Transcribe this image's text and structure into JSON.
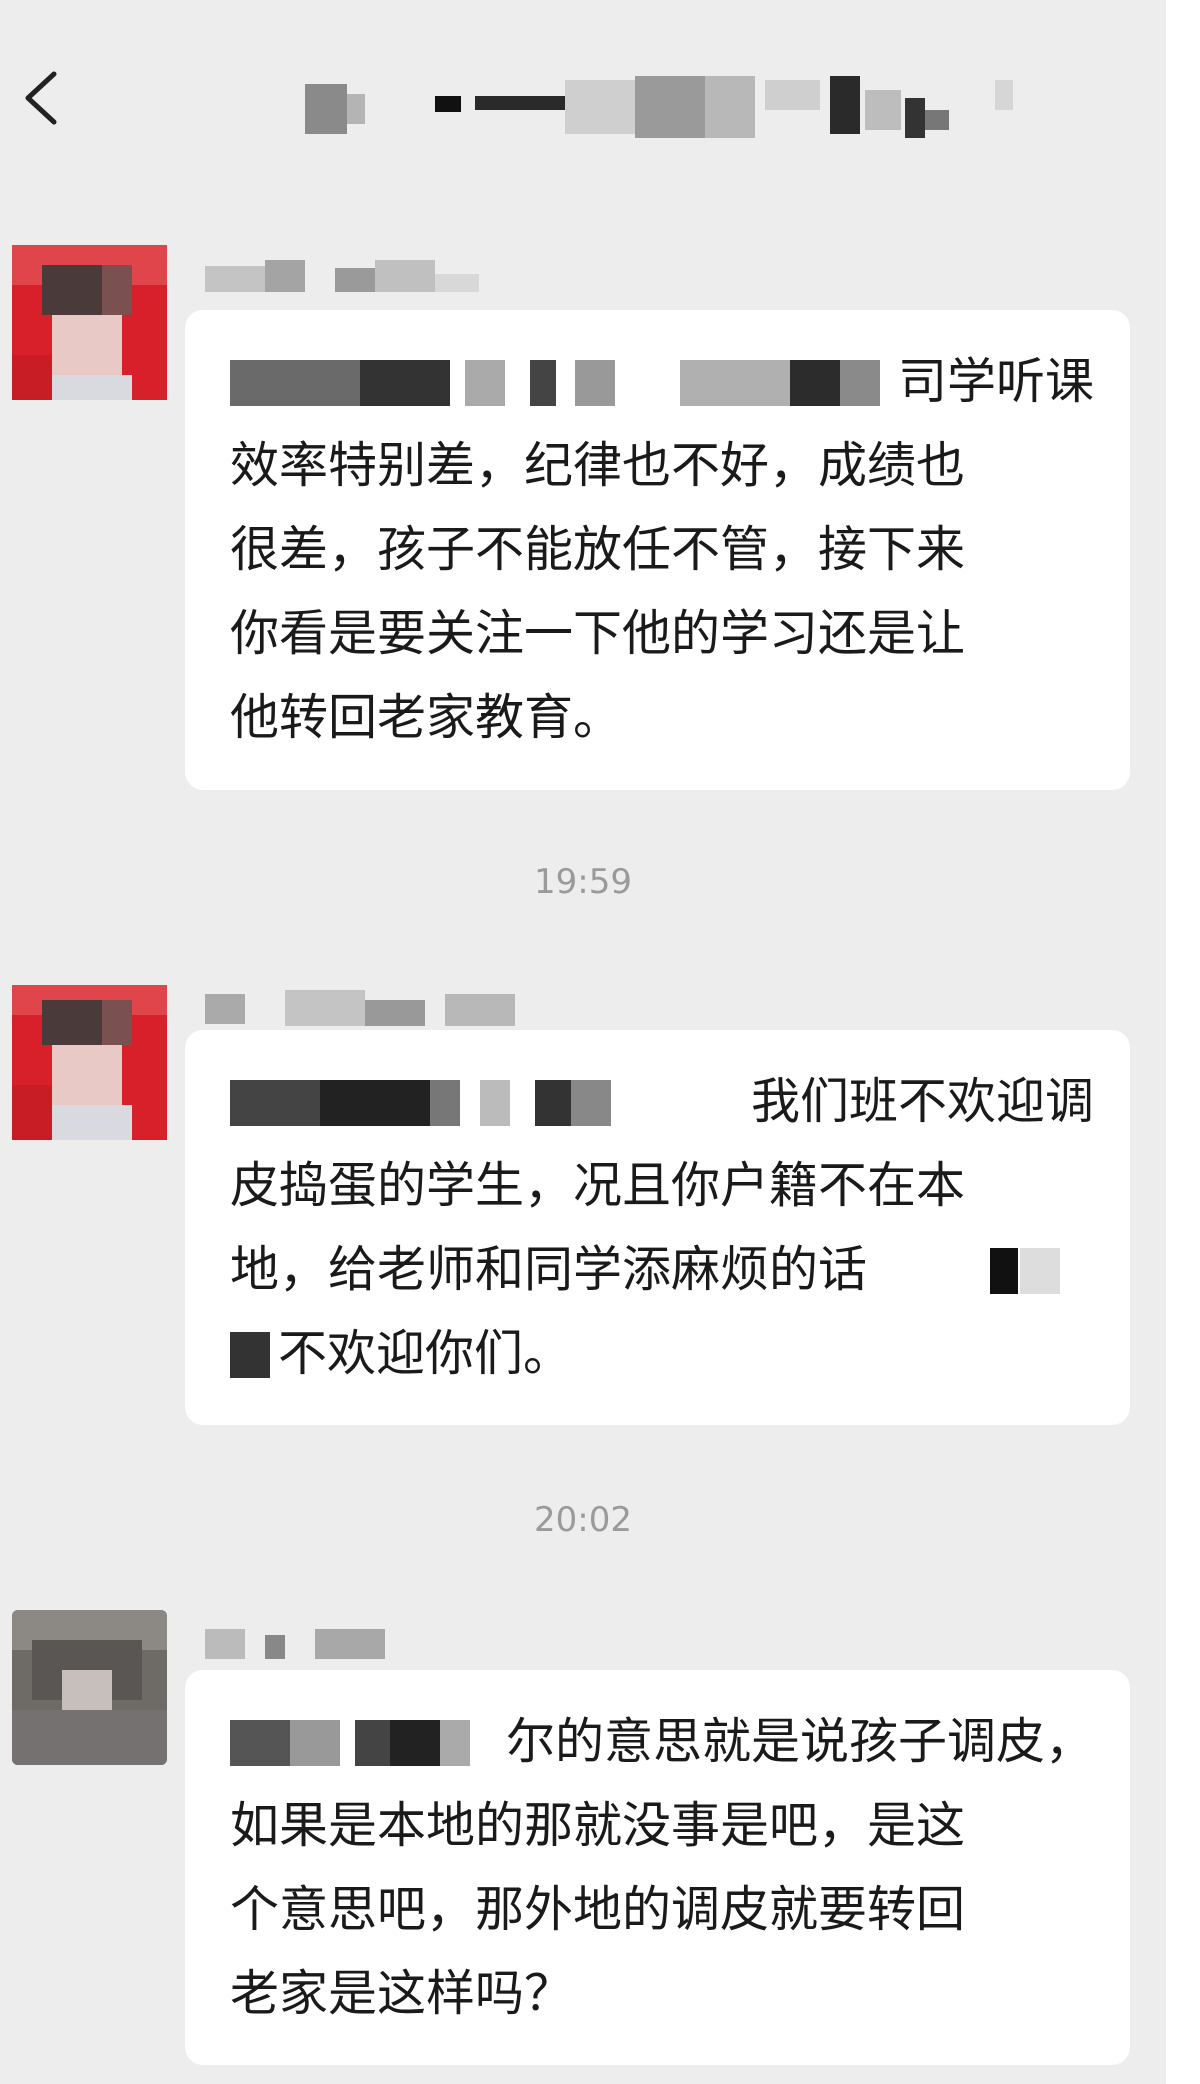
{
  "header": {
    "back_icon": "chevron-left-icon",
    "title_redacted": true
  },
  "messages": [
    {
      "sender_redacted": true,
      "avatar_color": "#d8202a",
      "lines": [
        "司学听课",
        "效率特别差，纪律也不好，成绩也",
        "很差，孩子不能放任不管，接下来",
        "你看是要关注一下他的学习还是让",
        "他转回老家教育。"
      ]
    },
    {
      "time": "19:59"
    },
    {
      "sender_redacted": true,
      "avatar_color": "#d8202a",
      "lines": [
        "我们班不欢迎调",
        "皮捣蛋的学生，况且你户籍不在本",
        "地，给老师和同学添麻烦的话",
        "不欢迎你们。"
      ]
    },
    {
      "time": "20:02"
    },
    {
      "sender_redacted": true,
      "avatar_color": "#6e6a66",
      "lines": [
        "尔的意思就是说孩子调皮，",
        "如果是本地的那就没事是吧，是这",
        "个意思吧，那外地的调皮就要转回",
        "老家是这样吗？"
      ]
    }
  ],
  "colors": {
    "background": "#ededed",
    "bubble": "#ffffff",
    "text": "#1a1a1a",
    "timestamp": "#9a9a9a"
  }
}
